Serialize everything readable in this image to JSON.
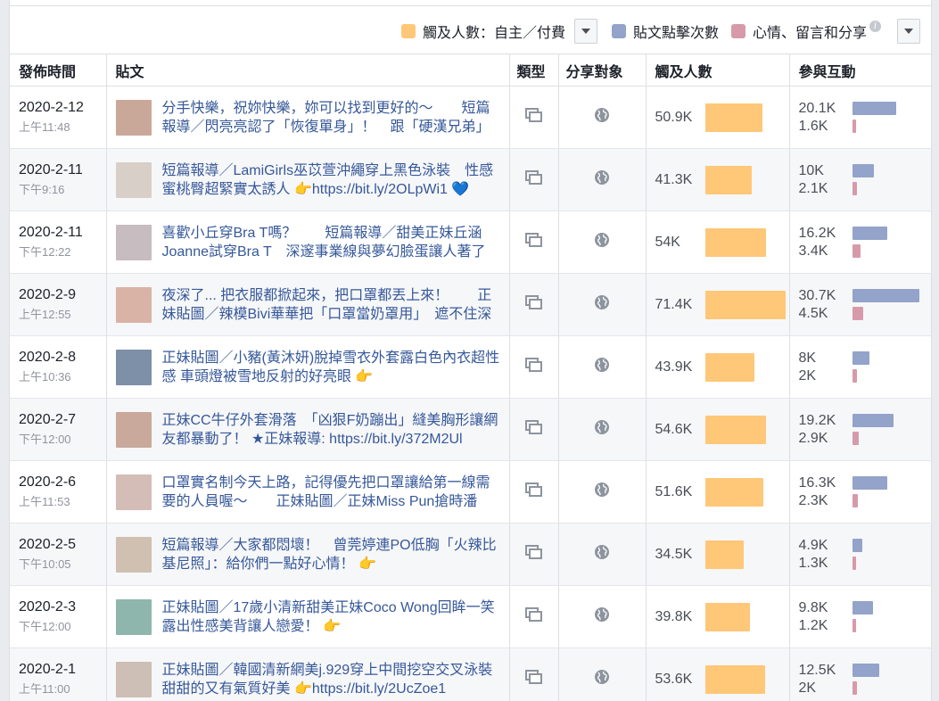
{
  "legend": {
    "reach_label": "觸及人數：自主／付費",
    "clicks_label": "貼文點擊次數",
    "reactions_label": "心情、留言和分享",
    "info_glyph": "i"
  },
  "colors": {
    "reach": "#ffc778",
    "clicks": "#93a3c9",
    "reactions": "#d79aaa"
  },
  "columns": {
    "published": "發佈時間",
    "post": "貼文",
    "type": "類型",
    "targeting": "分享對象",
    "reach": "觸及人數",
    "engagement": "參與互動"
  },
  "rows": [
    {
      "date": "2020-2-12",
      "time": "上午11:48",
      "text": "分手快樂，祝妳快樂，妳可以找到更好的～　　短篇報導／閃亮亮認了「恢復單身」！　跟「硬漢兄弟」",
      "reach": "50.9K",
      "reach_value": 50.9,
      "clicks": "20.1K",
      "clicks_value": 20.1,
      "reactions": "1.6K",
      "reactions_value": 1.6,
      "thumb": "#c9a89a"
    },
    {
      "date": "2020-2-11",
      "time": "下午9:16",
      "text": "短篇報導／LamiGirls巫苡萱沖繩穿上黑色泳裝　性感蜜桃臀超緊實太誘人 👉https://bit.ly/2OLpWi1 💙",
      "reach": "41.3K",
      "reach_value": 41.3,
      "clicks": "10K",
      "clicks_value": 10,
      "reactions": "2.1K",
      "reactions_value": 2.1,
      "thumb": "#d8cfc8"
    },
    {
      "date": "2020-2-11",
      "time": "下午12:22",
      "text": "喜歡小丘穿Bra T嗎？　　短篇報導／甜美正妹丘涵Joanne試穿Bra T　深邃事業線與夢幻臉蛋讓人著了迷",
      "reach": "54K",
      "reach_value": 54,
      "clicks": "16.2K",
      "clicks_value": 16.2,
      "reactions": "3.4K",
      "reactions_value": 3.4,
      "thumb": "#c7bcc0"
    },
    {
      "date": "2020-2-9",
      "time": "上午12:55",
      "text": "夜深了... 把衣服都掀起來，把口罩都丟上來！　　正妹貼圖／辣模Bivi華華把「口罩當奶罩用」　遮不住深",
      "reach": "71.4K",
      "reach_value": 71.4,
      "clicks": "30.7K",
      "clicks_value": 30.7,
      "reactions": "4.5K",
      "reactions_value": 4.5,
      "thumb": "#d9b3a6"
    },
    {
      "date": "2020-2-8",
      "time": "上午10:36",
      "text": "正妹貼圖／小豬(黃沐妍)脫掉雪衣外套露白色內衣超性感 車頭燈被雪地反射的好亮眼 👉",
      "reach": "43.9K",
      "reach_value": 43.9,
      "clicks": "8K",
      "clicks_value": 8,
      "reactions": "2K",
      "reactions_value": 2,
      "thumb": "#7e8fa8"
    },
    {
      "date": "2020-2-7",
      "time": "下午12:00",
      "text": "正妹CC牛仔外套滑落　「凶狠F奶蹦出」縫美胸形讓網友都暴動了！ ★正妹報導: https://bit.ly/372M2Ul",
      "reach": "54.6K",
      "reach_value": 54.6,
      "clicks": "19.2K",
      "clicks_value": 19.2,
      "reactions": "2.9K",
      "reactions_value": 2.9,
      "thumb": "#c8a99b"
    },
    {
      "date": "2020-2-6",
      "time": "上午11:53",
      "text": "口罩實名制今天上路，記得優先把口罩讓給第一線需要的人員喔～　　正妹貼圖／正妹Miss Pun搶時潘「不",
      "reach": "51.6K",
      "reach_value": 51.6,
      "clicks": "16.3K",
      "clicks_value": 16.3,
      "reactions": "2.3K",
      "reactions_value": 2.3,
      "thumb": "#d4bdb6"
    },
    {
      "date": "2020-2-5",
      "time": "下午10:05",
      "text": "短篇報導／大家都悶壞！　曾莞婷連PO低胸「火辣比基尼照」：給你們一點好心情！ 👉",
      "reach": "34.5K",
      "reach_value": 34.5,
      "clicks": "4.9K",
      "clicks_value": 4.9,
      "reactions": "1.3K",
      "reactions_value": 1.3,
      "thumb": "#cfc0b2"
    },
    {
      "date": "2020-2-3",
      "time": "下午12:00",
      "text": "正妹貼圖／17歲小清新甜美正妹Coco Wong回眸一笑　露出性感美背讓人戀愛！ 👉",
      "reach": "39.8K",
      "reach_value": 39.8,
      "clicks": "9.8K",
      "clicks_value": 9.8,
      "reactions": "1.2K",
      "reactions_value": 1.2,
      "thumb": "#8fb6ad"
    },
    {
      "date": "2020-2-1",
      "time": "上午11:00",
      "text": "正妹貼圖／韓國清新網美j.929穿上中間挖空交叉泳裝　甜甜的又有氣質好美 👉https://bit.ly/2UcZoe1",
      "reach": "53.6K",
      "reach_value": 53.6,
      "clicks": "12.5K",
      "clicks_value": 12.5,
      "reactions": "2K",
      "reactions_value": 2,
      "thumb": "#cdbfb5"
    }
  ]
}
